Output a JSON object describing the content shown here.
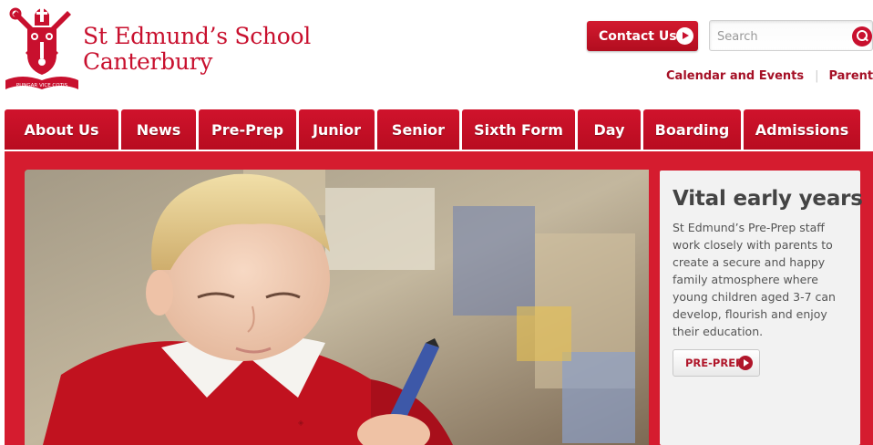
{
  "header": {
    "school_name_line1": "St Edmund’s School",
    "school_name_line2": "Canterbury",
    "logo_motto": "PUNGAR VICE COTIS",
    "contact_label": "Contact Us",
    "search_placeholder": "Search",
    "links": [
      {
        "label": "Calendar and Events"
      },
      {
        "label": "Parents’ Zon"
      }
    ]
  },
  "nav": {
    "items": [
      {
        "label": "About Us"
      },
      {
        "label": "News"
      },
      {
        "label": "Pre-Prep"
      },
      {
        "label": "Junior"
      },
      {
        "label": "Senior"
      },
      {
        "label": "Sixth Form"
      },
      {
        "label": "Day"
      },
      {
        "label": "Boarding"
      },
      {
        "label": "Admissions"
      }
    ]
  },
  "promo": {
    "title": "Vital early years",
    "body": "St Edmund’s Pre-Prep staff work closely with parents to create a secure and happy family atmosphere where young children aged 3-7 can develop, flourish and enjoy their education.",
    "button_label": "PRE-PREP"
  },
  "colors": {
    "brand_red": "#c8102e",
    "band_red": "#d51c2f",
    "panel_grey": "#f2f2f2",
    "text_dark": "#444444"
  },
  "icons": {
    "logo": "school-crest-icon",
    "contact": "play-circle-icon",
    "search": "search-icon",
    "promo_button": "play-circle-icon"
  }
}
